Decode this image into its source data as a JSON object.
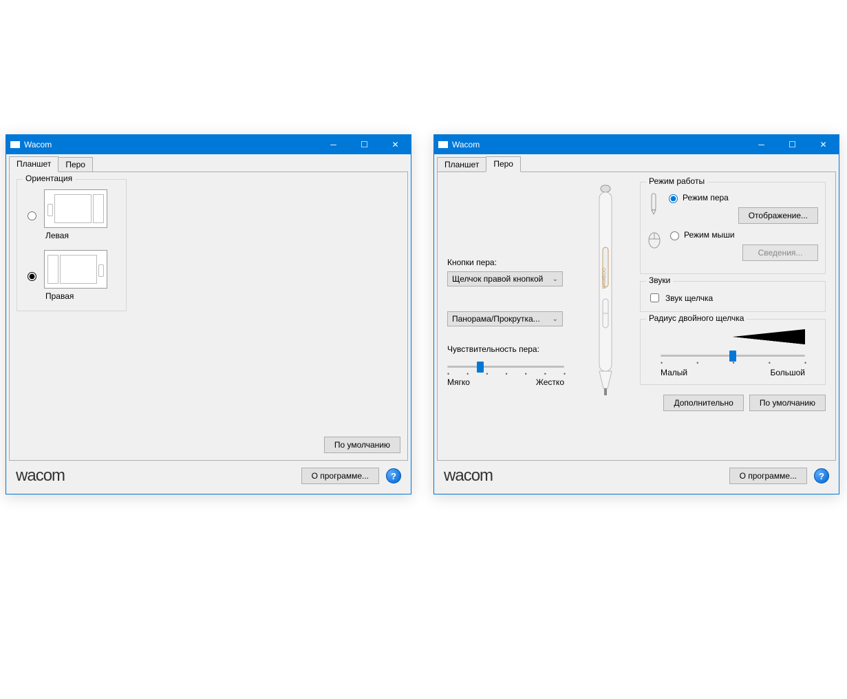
{
  "window_title": "Wacom",
  "tabs": {
    "tablet": "Планшет",
    "pen": "Перо"
  },
  "orientation": {
    "title": "Ориентация",
    "left": "Левая",
    "right": "Правая",
    "selected": "right"
  },
  "buttons": {
    "default": "По умолчанию",
    "about": "О программе...",
    "advanced": "Дополнительно",
    "mapping": "Отображение...",
    "details": "Сведения..."
  },
  "logo": "wacom",
  "pen": {
    "buttons_label": "Кнопки пера:",
    "btn_upper": "Щелчок правой кнопкой",
    "btn_lower": "Панорама/Прокрутка...",
    "sensitivity_label": "Чувствительность пера:",
    "soft": "Мягко",
    "hard": "Жестко",
    "sensitivity_ticks": 7,
    "sensitivity_pos_pct": 28
  },
  "mode": {
    "title": "Режим работы",
    "pen_mode": "Режим пера",
    "mouse_mode": "Режим мыши",
    "selected": "pen"
  },
  "sounds": {
    "title": "Звуки",
    "click_sound": "Звук щелчка",
    "checked": false
  },
  "dblclick": {
    "title": "Радиус двойного щелчка",
    "small": "Малый",
    "large": "Большой",
    "ticks": 5,
    "pos_pct": 50
  }
}
